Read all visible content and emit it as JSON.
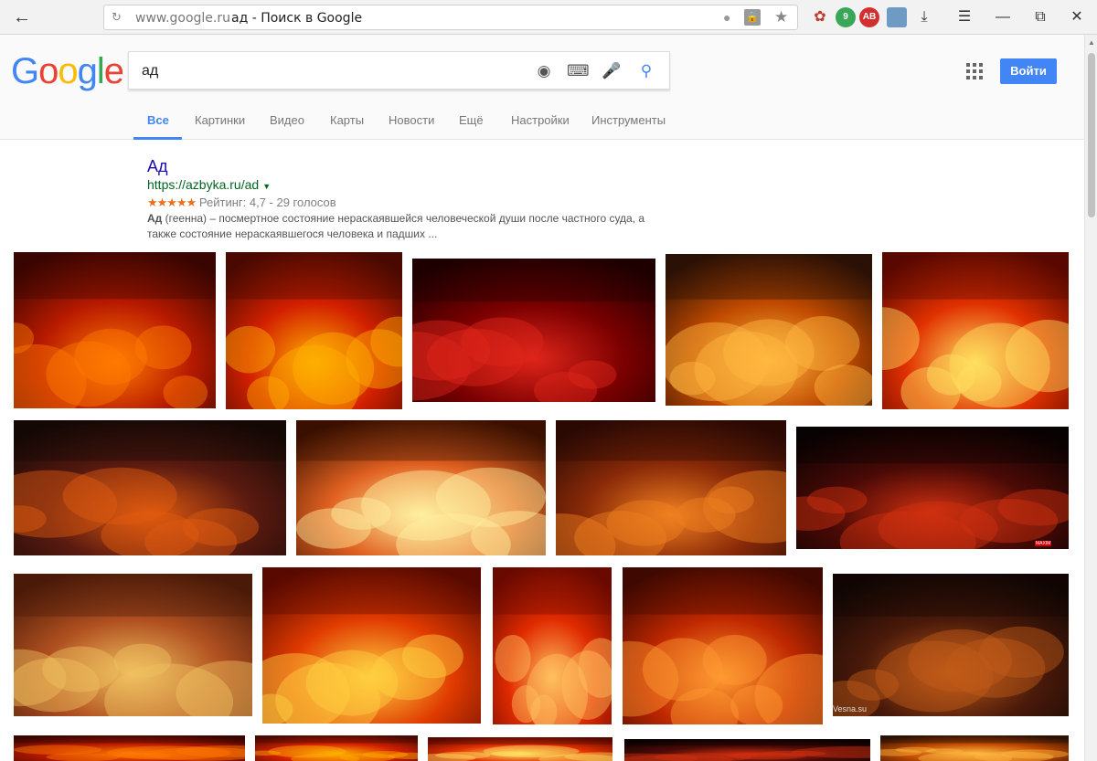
{
  "browser": {
    "domain": "www.google.ru",
    "title": "ад - Поиск в Google",
    "window_controls": [
      "menu-icon",
      "minimize-icon",
      "restore-icon",
      "close-icon"
    ]
  },
  "google": {
    "logo": [
      "G",
      "o",
      "o",
      "g",
      "l",
      "e"
    ],
    "logo_colors": [
      "#4285f4",
      "#ea4335",
      "#fbbc05",
      "#4285f4",
      "#34a853",
      "#ea4335"
    ],
    "query": "ад",
    "signin_label": "Войти",
    "tabs": [
      {
        "label": "Все",
        "active": true
      },
      {
        "label": "Картинки"
      },
      {
        "label": "Видео"
      },
      {
        "label": "Карты"
      },
      {
        "label": "Новости"
      },
      {
        "label": "Ещё"
      },
      {
        "label": "Настройки"
      },
      {
        "label": "Инструменты"
      }
    ]
  },
  "result": {
    "title": "Ад",
    "url": "https://azbyka.ru/ad",
    "stars": "★★★★★",
    "rating_text": "Рейтинг: 4,7 - 29 голосов",
    "snippet_bold": "Ад",
    "snippet_line1": " (геенна) – посмертное состояние нераскаявшейся человеческой души после частного суда, а",
    "snippet_line2": "также состояние нераскаявшегося человека и падших ..."
  },
  "images": {
    "watermark_1": "MAXIM",
    "watermark_2": "Vesna.su"
  },
  "colors": {
    "accent": "#4285f4",
    "link": "#1a0dab",
    "url": "#006621",
    "stars": "#e7711b"
  }
}
